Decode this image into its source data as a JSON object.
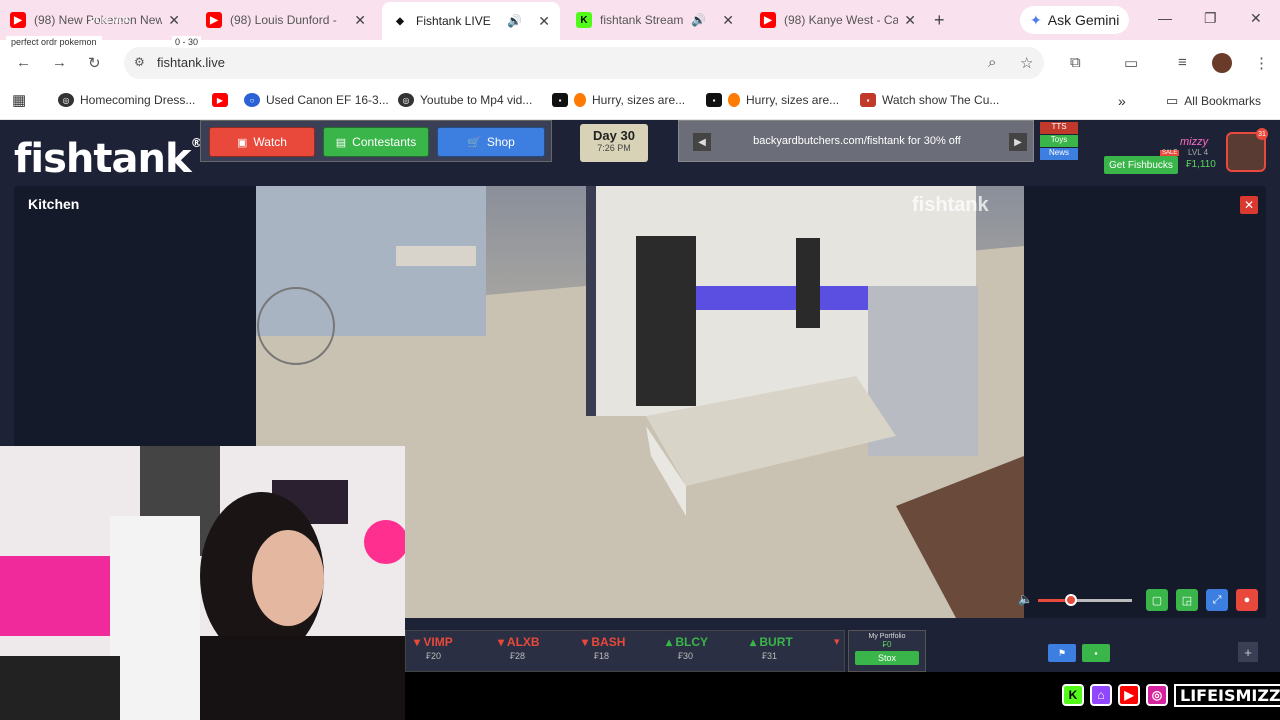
{
  "browser": {
    "tabs": [
      {
        "title": "(98) New Pokemon New",
        "icon": "youtube-icon"
      },
      {
        "title": "(98) Louis Dunford -",
        "icon": "youtube-icon"
      },
      {
        "title": "Fishtank LIVE",
        "icon": "fishtank-icon",
        "active": true
      },
      {
        "title": "fishtank Stream -",
        "icon": "kick-icon"
      },
      {
        "title": "(98) Kanye West - Ca",
        "icon": "youtube-icon"
      }
    ],
    "ask_gemini": "Ask Gemini",
    "url": "fishtank.live",
    "bookmarks": [
      "Homecoming Dress...",
      "Used Canon EF 16-3...",
      "Youtube to Mp4 vid...",
      "Hurry, sizes are...",
      "Hurry, sizes are...",
      "Watch show The Cu..."
    ],
    "all_bookmarks": "All Bookmarks",
    "overlay_note": "perfect ordr pokemon",
    "overlay_pokemon": "POKEMON",
    "overlay_time": "0 - 30"
  },
  "site": {
    "logo": "fishtank",
    "nav": {
      "watch": "Watch",
      "contestants": "Contestants",
      "shop": "Shop"
    },
    "day": "Day 30",
    "time": "7:26 PM",
    "ad_text": "backyardbutchers.com/fishtank for 30% off",
    "side_tabs": [
      "TTS",
      "Toys",
      "News"
    ],
    "user": {
      "name": "mizzy",
      "level": "LVL 4",
      "fishbucks_label": "Get Fishbucks",
      "sale": "SALE",
      "balance": "₣1,110",
      "notifications": "31"
    },
    "camera_title": "Kitchen",
    "watermark": "fishtank",
    "volume": 0.35,
    "stocks": [
      {
        "name": "VIMP",
        "price": "₣20",
        "dir": "down"
      },
      {
        "name": "ALXB",
        "price": "₣28",
        "dir": "down"
      },
      {
        "name": "BASH",
        "price": "₣18",
        "dir": "down"
      },
      {
        "name": "BLCY",
        "price": "₣30",
        "dir": "up"
      },
      {
        "name": "BURT",
        "price": "₣31",
        "dir": "up"
      }
    ],
    "portfolio": {
      "label": "My Portfolio",
      "value": "₣0",
      "button": "Stox"
    }
  },
  "stream": {
    "handle": "LIFEISMIZZY"
  },
  "colors": {
    "accent_red": "#e8493a",
    "accent_green": "#39b54a",
    "accent_blue": "#3c7fe0",
    "tab_strip": "#fae1ee"
  }
}
